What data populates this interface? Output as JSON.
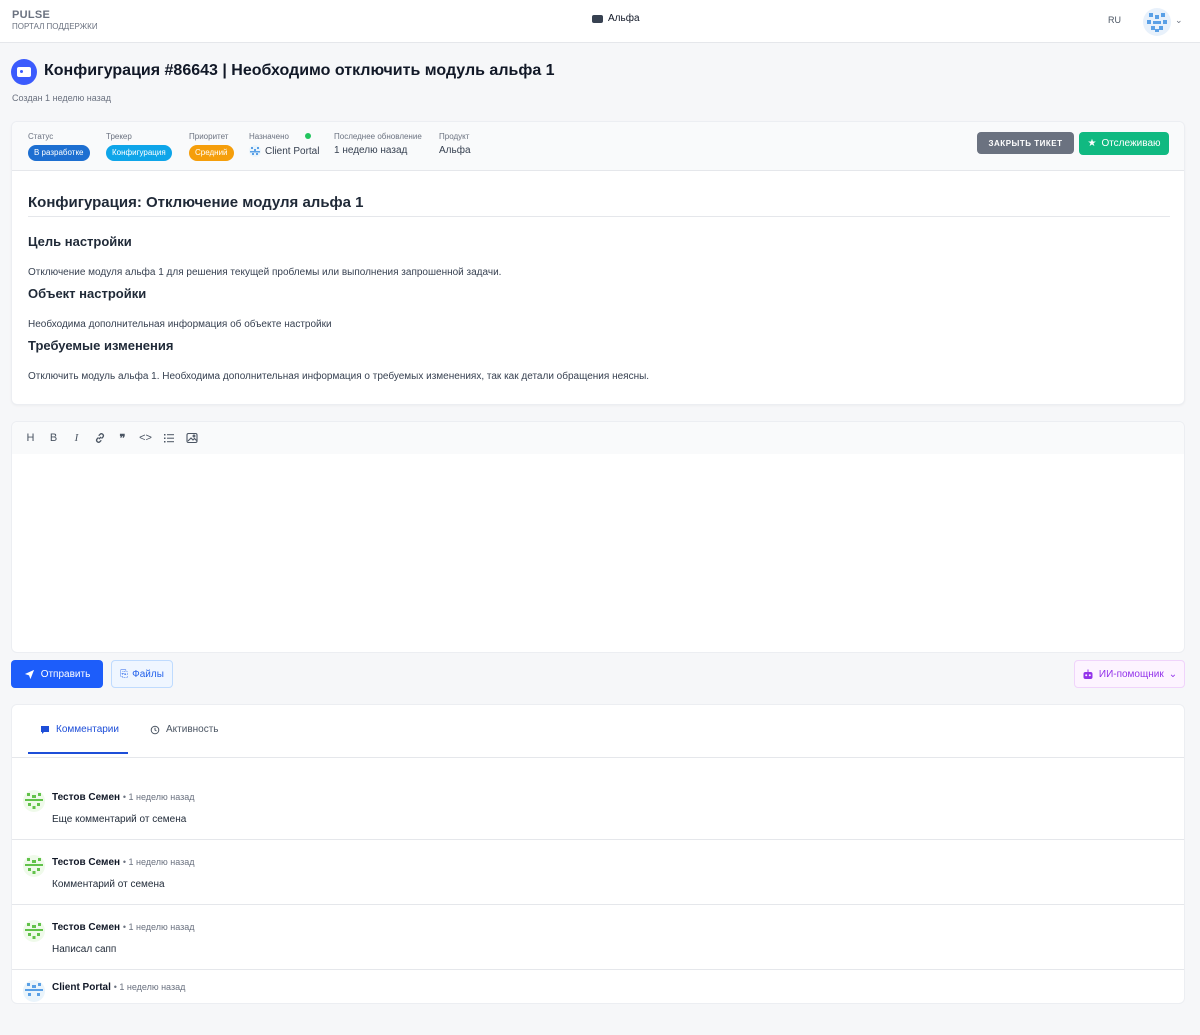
{
  "header": {
    "brand": "PULSE",
    "brand_sub": "ПОРТАЛ ПОДДЕРЖКИ",
    "project": "Альфа",
    "lang": "RU"
  },
  "ticket": {
    "title": "Конфигурация #86643 | Необходимо отключить модуль альфа 1",
    "created": "Создан 1 неделю назад",
    "meta": {
      "status_label": "Статус",
      "status": "В разработке",
      "tracker_label": "Трекер",
      "tracker": "Конфигурация",
      "priority_label": "Приоритет",
      "priority": "Средний",
      "assigned_label": "Назначено",
      "assigned": "Client Portal",
      "updated_label": "Последнее обновление",
      "updated": "1 неделю назад",
      "product_label": "Продукт",
      "product": "Альфа"
    },
    "close_button": "ЗАКРЫТЬ ТИКЕТ",
    "watch_button": "Отслеживаю",
    "description": {
      "h1": "Конфигурация: Отключение модуля альфа 1",
      "goal_title": "Цель настройки",
      "goal_text": "Отключение модуля альфа 1 для решения текущей проблемы или выполнения запрошенной задачи.",
      "object_title": "Объект настройки",
      "object_text": "Необходима дополнительная информация об объекте настройки",
      "changes_title": "Требуемые изменения",
      "changes_text": "Отключить модуль альфа 1. Необходима дополнительная информация о требуемых изменениях, так как детали обращения неясны."
    }
  },
  "editor": {
    "tools": [
      "H",
      "B",
      "I",
      "link",
      "quote",
      "code",
      "list",
      "image"
    ]
  },
  "actions": {
    "send": "Отправить",
    "files": "Файлы",
    "ai": "ИИ-помощник"
  },
  "tabs": {
    "comments": "Комментарии",
    "activity": "Активность"
  },
  "comments": [
    {
      "author": "Тестов Семен",
      "time": "• 1 неделю назад",
      "text": "Еще комментарий от семена"
    },
    {
      "author": "Тестов Семен",
      "time": "• 1 неделю назад",
      "text": "Комментарий от семена"
    },
    {
      "author": "Тестов Семен",
      "time": "• 1 неделю назад",
      "text": "Написал сапп"
    },
    {
      "author": "Client Portal",
      "time": "• 1 неделю назад",
      "text": ""
    }
  ],
  "colors": {
    "status": "#1d6fd1",
    "tracker": "#0ea5e9",
    "priority": "#f59e0b",
    "primary": "#1d5dfa",
    "success": "#10b981"
  }
}
